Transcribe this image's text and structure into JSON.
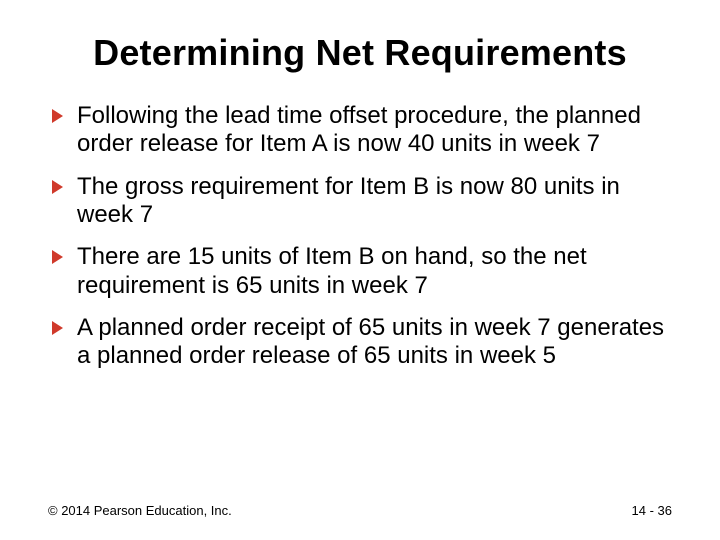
{
  "title": "Determining Net Requirements",
  "bullets": [
    "Following the lead time offset procedure, the planned order release for Item A is now 40 units in week 7",
    "The gross requirement for Item B is now 80 units in week 7",
    "There are 15 units of Item B on hand, so the net requirement is 65 units in week 7",
    "A planned order receipt of 65 units in week 7 generates a planned order release of 65 units in week 5"
  ],
  "footer": {
    "copyright": "© 2014 Pearson Education, Inc.",
    "page": "14 - 36"
  }
}
